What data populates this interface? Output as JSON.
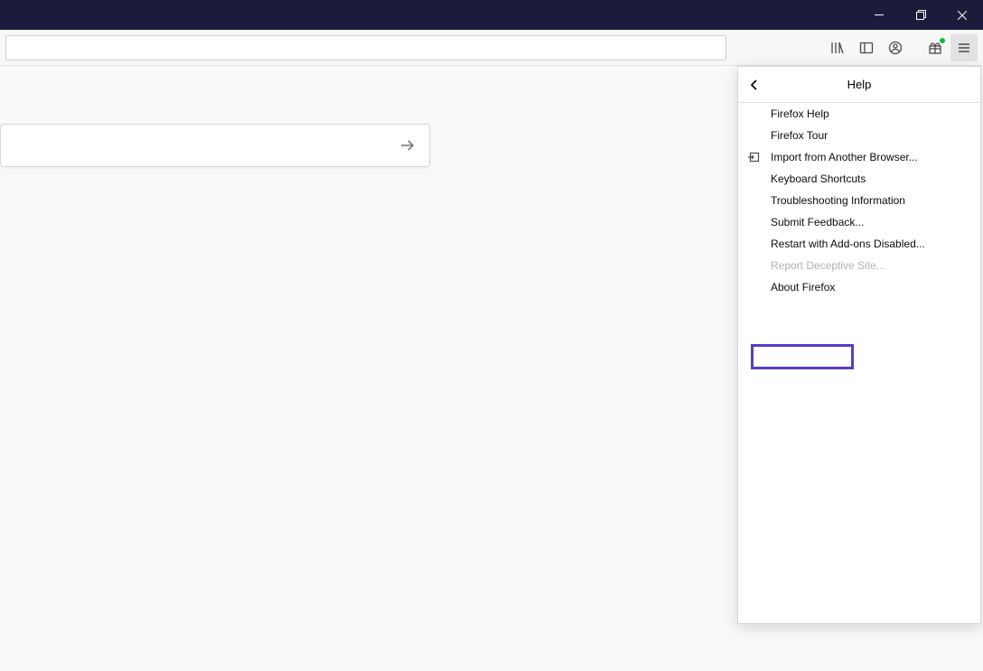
{
  "helpPanel": {
    "title": "Help",
    "items": [
      {
        "label": "Firefox Help",
        "icon": null,
        "disabled": false
      },
      {
        "label": "Firefox Tour",
        "icon": null,
        "disabled": false
      },
      {
        "label": "Import from Another Browser...",
        "icon": "import",
        "disabled": false
      },
      {
        "label": "Keyboard Shortcuts",
        "icon": null,
        "disabled": false
      },
      {
        "label": "Troubleshooting Information",
        "icon": null,
        "disabled": false
      },
      {
        "label": "Submit Feedback...",
        "icon": null,
        "disabled": false
      },
      {
        "label": "Restart with Add-ons Disabled...",
        "icon": null,
        "disabled": false
      },
      {
        "label": "Report Deceptive Site...",
        "icon": null,
        "disabled": true
      },
      {
        "label": "About Firefox",
        "icon": null,
        "disabled": false
      }
    ]
  }
}
